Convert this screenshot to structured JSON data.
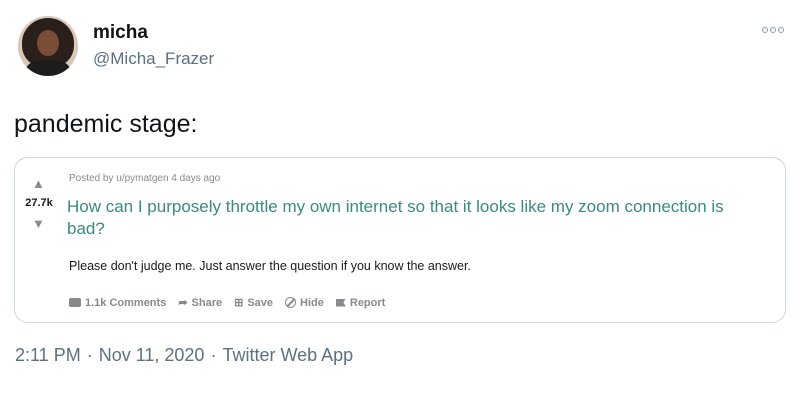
{
  "author": {
    "display_name": "micha",
    "handle": "@Micha_Frazer",
    "avatar_icon": "user-avatar"
  },
  "more_icon": "more-options-icon",
  "tweet_text": "pandemic stage:",
  "reddit_post": {
    "vote_count": "27.7k",
    "posted_by": "Posted by u/pymatgen 4 days ago",
    "title": "How can I purposely throttle my own internet so that it looks like my zoom connection is bad?",
    "body": "Please don't judge me. Just answer the question if you know the answer.",
    "actions": {
      "comments": "1.1k Comments",
      "share": "Share",
      "save": "Save",
      "hide": "Hide",
      "report": "Report"
    },
    "colors": {
      "title": "#3a8a7e",
      "meta": "#878a8c"
    }
  },
  "meta": {
    "time": "2:11 PM",
    "sep1": "·",
    "date": "Nov 11, 2020",
    "sep2": "·",
    "source": "Twitter Web App"
  }
}
